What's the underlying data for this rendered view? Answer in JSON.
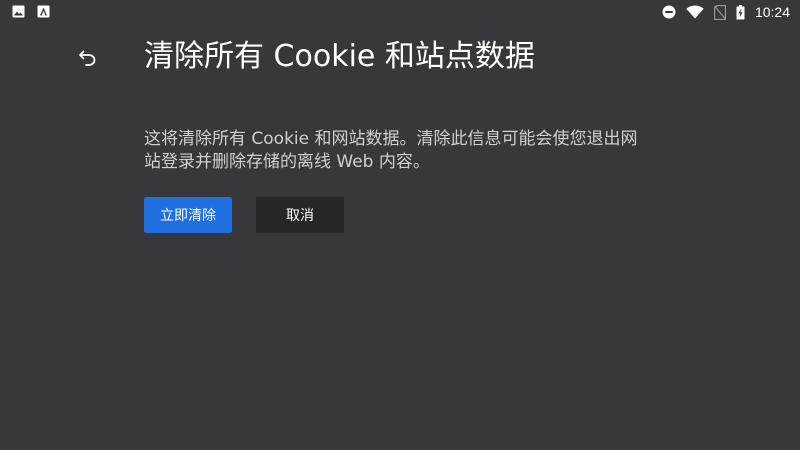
{
  "status_bar": {
    "time": "10:24",
    "left_icons": [
      "image-icon",
      "app-notification-icon"
    ],
    "right_icons": [
      "do-not-disturb-icon",
      "wifi-icon",
      "no-sim-icon",
      "battery-icon"
    ]
  },
  "header": {
    "back_icon": "back-arrow-icon",
    "title": "清除所有 Cookie 和站点数据"
  },
  "main": {
    "description": "这将清除所有 Cookie 和网站数据。清除此信息可能会使您退出网站登录并删除存储的离线 Web 内容。",
    "confirm_label": "立即清除",
    "cancel_label": "取消"
  },
  "colors": {
    "background": "#38373c",
    "primary_button": "#1f6fe0",
    "secondary_button": "#27262b",
    "text": "#ffffff",
    "description_text": "#cfcfd2"
  }
}
